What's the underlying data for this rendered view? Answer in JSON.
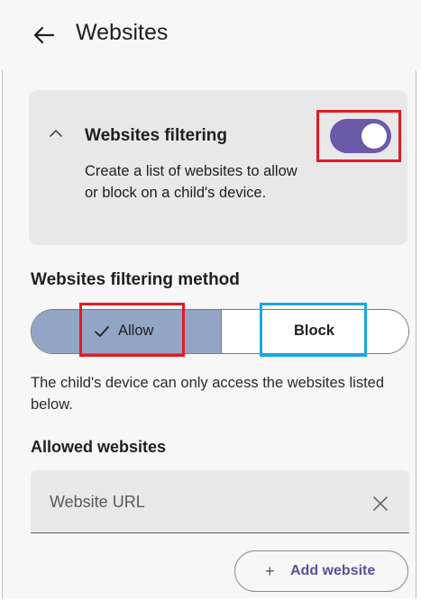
{
  "header": {
    "title": "Websites",
    "back_icon": "arrow-left-icon"
  },
  "filter_card": {
    "title": "Websites filtering",
    "description": "Create a list of websites to allow or block on a child's device.",
    "enabled": true,
    "toggle_color": "#6b5aa8"
  },
  "method": {
    "title": "Websites filtering method",
    "options": [
      {
        "label": "Allow",
        "selected": true
      },
      {
        "label": "Block",
        "selected": false
      }
    ],
    "helper": "The child's device can only access the websites listed below."
  },
  "allowed": {
    "title": "Allowed websites",
    "url_placeholder": "Website URL",
    "add_label": "Add website",
    "add_icon": "+"
  },
  "highlights": {
    "red": "#e01b24",
    "blue": "#1aa6e6"
  }
}
